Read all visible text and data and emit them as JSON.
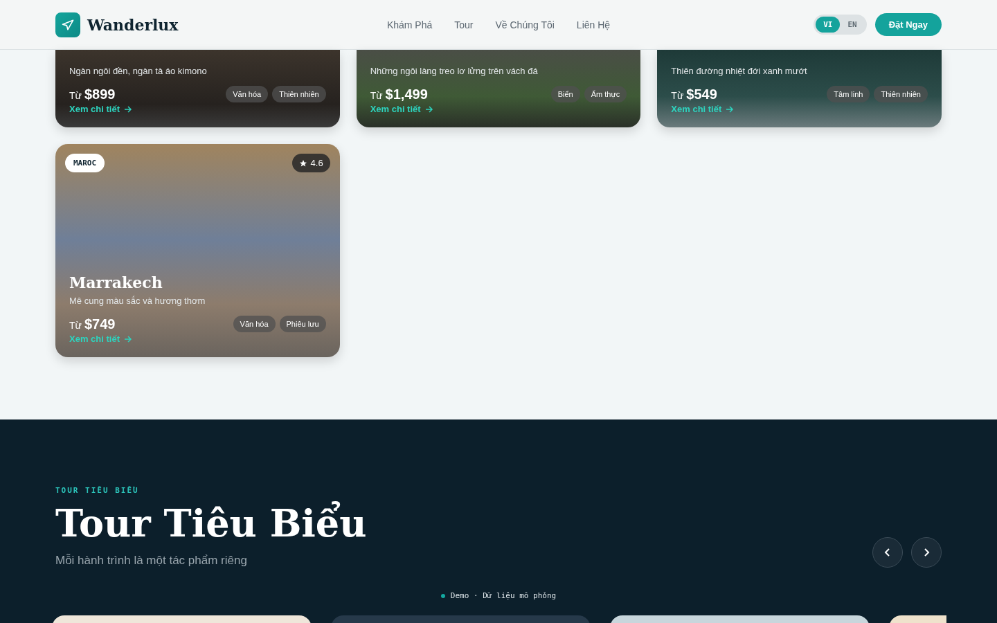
{
  "header": {
    "brand": "Wanderlux",
    "nav": [
      "Khám Phá",
      "Tour",
      "Về Chúng Tôi",
      "Liên Hệ"
    ],
    "languages": [
      {
        "label": "VI",
        "selected": true
      },
      {
        "label": "EN",
        "selected": false
      }
    ],
    "cta": "Đặt Ngay"
  },
  "destinations": [
    {
      "description": "Ngàn ngôi đền, ngàn tà áo kimono",
      "price_prefix": "Từ",
      "price": "$899",
      "tags": [
        "Văn hóa",
        "Thiên nhiên"
      ],
      "link": "Xem chi tiết"
    },
    {
      "description": "Những ngôi làng treo lơ lửng trên vách đá",
      "price_prefix": "Từ",
      "price": "$1,499",
      "tags": [
        "Biển",
        "Ẩm thực"
      ],
      "link": "Xem chi tiết"
    },
    {
      "description": "Thiên đường nhiệt đới xanh mướt",
      "price_prefix": "Từ",
      "price": "$549",
      "tags": [
        "Tâm linh",
        "Thiên nhiên"
      ],
      "link": "Xem chi tiết"
    },
    {
      "badge": "MAROC",
      "rating": "4.6",
      "title": "Marrakech",
      "description": "Mê cung màu sắc và hương thơm",
      "price_prefix": "Từ",
      "price": "$749",
      "tags": [
        "Văn hóa",
        "Phiêu lưu"
      ],
      "link": "Xem chi tiết"
    }
  ],
  "featured": {
    "eyebrow": "TOUR TIÊU BIỂU",
    "title": "Tour Tiêu Biểu",
    "subtitle": "Mỗi hành trình là một tác phẩm riêng",
    "note": "Demo · Dữ liệu mô phỏng"
  }
}
